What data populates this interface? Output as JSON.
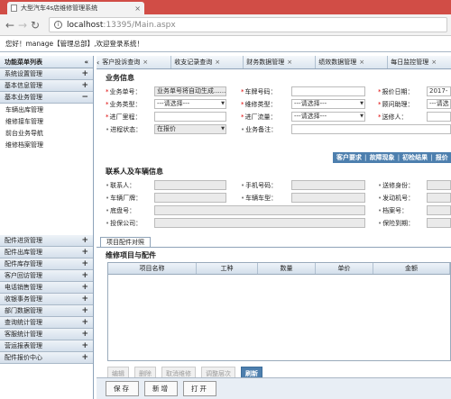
{
  "browser": {
    "tab_title": "大型汽车4s店维修管理系统",
    "close_glyph": "×",
    "url_host": "localhost",
    "url_path": ":13395/Main.aspx"
  },
  "greeting": "您好！manage【管理总部】,欢迎登录系统！",
  "sidebar": {
    "title": "功能菜单列表",
    "collapse": "«",
    "top_sections": [
      {
        "label": "系统设置管理",
        "toggle": "+"
      },
      {
        "label": "基本信息管理",
        "toggle": "+"
      },
      {
        "label": "基本业务管理",
        "toggle": "−"
      }
    ],
    "sub_items": [
      "车辆出库管理",
      "维修接车管理",
      "前台业务导航",
      "维修档案管理"
    ],
    "bottom_sections": [
      {
        "label": "配件进货管理",
        "toggle": "+"
      },
      {
        "label": "配件出库管理",
        "toggle": "+"
      },
      {
        "label": "配件库存管理",
        "toggle": "+"
      },
      {
        "label": "客户回访管理",
        "toggle": "+"
      },
      {
        "label": "电话销售管理",
        "toggle": "+"
      },
      {
        "label": "收银事务管理",
        "toggle": "+"
      },
      {
        "label": "部门数据管理",
        "toggle": "+"
      },
      {
        "label": "查询统计管理",
        "toggle": "+"
      },
      {
        "label": "客服统计管理",
        "toggle": "+"
      },
      {
        "label": "营运报表管理",
        "toggle": "+"
      },
      {
        "label": "配件报价中心",
        "toggle": "+"
      }
    ]
  },
  "module_tabs": {
    "prev": "‹",
    "items": [
      "客户投诉查询",
      "收支记录查询",
      "财务数据管理",
      "绩效数据管理",
      "每日监控管理"
    ],
    "close": "×"
  },
  "business": {
    "title": "业务信息",
    "order_no_label": "业务单号：",
    "order_no_value": "业务单号将自动生成......",
    "plate_label": "车牌号码：",
    "plate_value": "",
    "quote_date_label": "报价日期：",
    "quote_date_value": "2017-",
    "biz_type_label": "业务类型：",
    "biz_type_value": "---请选择---",
    "repair_type_label": "维修类型：",
    "repair_type_value": "---请选择---",
    "advisor_label": "顾问助理：",
    "advisor_value": "---请选",
    "factory_time_label": "进厂里程：",
    "factory_time_value": "",
    "flow_label": "进厂流量：",
    "flow_value": "---请选择---",
    "repairer_label": "送修人：",
    "repairer_value": "",
    "progress_label": "进程状态：",
    "progress_value": "在报价",
    "remark_label": "业务备注：",
    "remark_value": ""
  },
  "action_bar": [
    "客户要求",
    "故障现象",
    "初检结果",
    "报价"
  ],
  "contact": {
    "title": "联系人及车辆信息",
    "contact_label": "联系人：",
    "phone_label": "手机号码：",
    "identity_label": "送修身份：",
    "brand_label": "车辆厂牌：",
    "model_label": "车辆车型：",
    "engine_label": "发动机号：",
    "vin_label": "底盘号：",
    "archive_label": "档案号：",
    "insurer_label": "投保公司：",
    "insure_date_label": "保险到期："
  },
  "panel_tab": "项目配件对照",
  "items_title": "维修项目与配件",
  "grid_columns": [
    "项目名称",
    "工种",
    "数量",
    "单价",
    "金额"
  ],
  "grid_tools": {
    "edit": "编辑",
    "delete": "删除",
    "cancel": "取消维修",
    "adjust": "调整层次",
    "refresh": "刷新"
  },
  "bottom_buttons": {
    "save": "保存",
    "new": "新增",
    "open": "打开"
  }
}
